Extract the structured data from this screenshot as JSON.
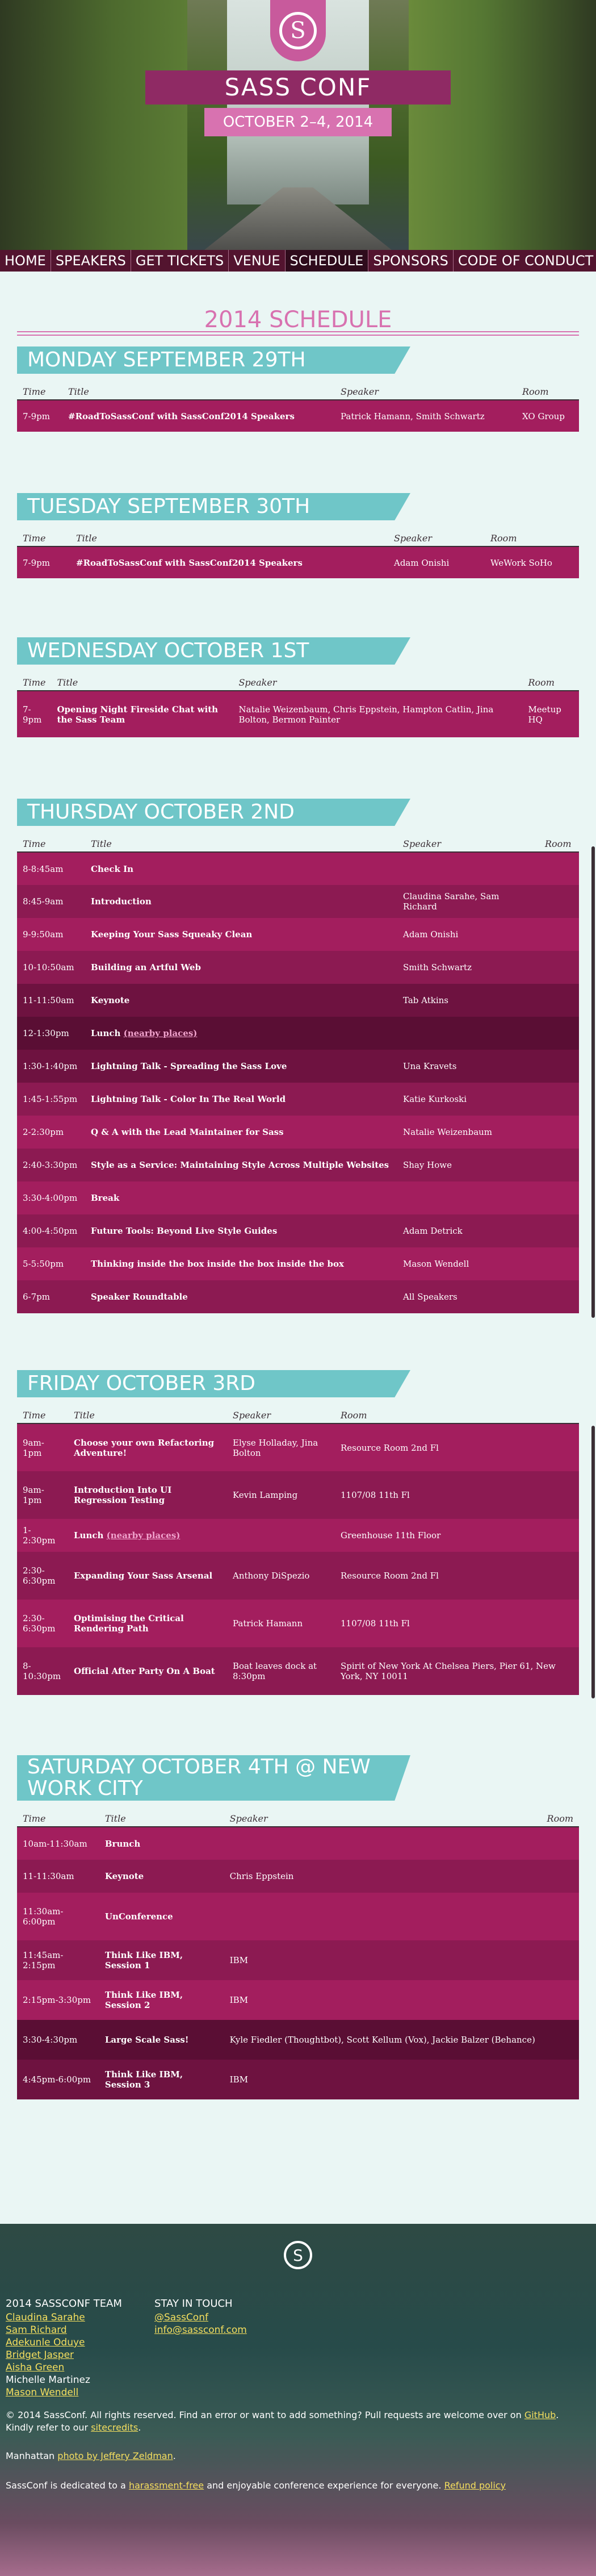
{
  "hero": {
    "logo_glyph": "S",
    "title": "SASS CONF",
    "dates": "OCTOBER 2–4, 2014"
  },
  "nav": {
    "items": [
      "HOME",
      "SPEAKERS",
      "GET TICKETS",
      "VENUE",
      "SCHEDULE",
      "SPONSORS",
      "CODE OF CONDUCT"
    ],
    "active": "SCHEDULE"
  },
  "page_title": "2014 SCHEDULE",
  "days": [
    {
      "heading": "MONDAY SEPTEMBER 29TH",
      "columns": [
        "Time",
        "Title",
        "Speaker",
        "Room"
      ],
      "rows": [
        [
          "7-9pm",
          "#RoadToSassConf with SassConf2014 Speakers",
          "Patrick Hamann, Smith Schwartz",
          "XO Group"
        ]
      ]
    },
    {
      "heading": "TUESDAY SEPTEMBER 30TH",
      "columns": [
        "Time",
        "Title",
        "Speaker",
        "Room"
      ],
      "rows": [
        [
          "7-9pm",
          "#RoadToSassConf with SassConf2014 Speakers",
          "Adam Onishi",
          "WeWork SoHo"
        ]
      ]
    },
    {
      "heading": "WEDNESDAY OCTOBER 1ST",
      "columns": [
        "Time",
        "Title",
        "Speaker",
        "Room"
      ],
      "rows": [
        [
          "7-9pm",
          "Opening Night Fireside Chat with the Sass Team",
          "Natalie Weizenbaum, Chris Eppstein, Hampton Catlin, Jina Bolton, Bermon Painter",
          "Meetup HQ"
        ]
      ]
    },
    {
      "heading": "THURSDAY OCTOBER 2ND",
      "columns": [
        "Time",
        "Title",
        "Speaker",
        "Room"
      ],
      "rows": [
        [
          "8-8:45am",
          "Check In",
          "",
          ""
        ],
        [
          "8:45-9am",
          "Introduction",
          "Claudina Sarahe, Sam Richard",
          ""
        ],
        [
          "9-9:50am",
          "Keeping Your Sass Squeaky Clean",
          "Adam Onishi",
          ""
        ],
        [
          "10-10:50am",
          "Building an Artful Web",
          "Smith Schwartz",
          ""
        ],
        [
          "11-11:50am",
          "Keynote",
          "Tab Atkins",
          ""
        ],
        [
          "12-1:30pm",
          "Lunch",
          "",
          ""
        ],
        [
          "1:30-1:40pm",
          "Lightning Talk - Spreading the Sass Love",
          "Una Kravets",
          ""
        ],
        [
          "1:45-1:55pm",
          "Lightning Talk - Color In The Real World",
          "Katie Kurkoski",
          ""
        ],
        [
          "2-2:30pm",
          "Q & A with the Lead Maintainer for Sass",
          "Natalie Weizenbaum",
          ""
        ],
        [
          "2:40-3:30pm",
          "Style as a Service: Maintaining Style Across Multiple Websites",
          "Shay Howe",
          ""
        ],
        [
          "3:30-4:00pm",
          "Break",
          "",
          ""
        ],
        [
          "4:00-4:50pm",
          "Future Tools: Beyond Live Style Guides",
          "Adam Detrick",
          ""
        ],
        [
          "5-5:50pm",
          "Thinking inside the box inside the box inside the box",
          "Mason Wendell",
          ""
        ],
        [
          "6-7pm",
          "Speaker Roundtable",
          "All Speakers",
          ""
        ]
      ],
      "lunch_link": "(nearby places)"
    },
    {
      "heading": "FRIDAY OCTOBER 3RD",
      "columns": [
        "Time",
        "Title",
        "Speaker",
        "Room"
      ],
      "rows": [
        [
          "9am-1pm",
          "Choose your own Refactoring Adventure!",
          "Elyse Holladay, Jina Bolton",
          "Resource Room 2nd Fl"
        ],
        [
          "9am-1pm",
          "Introduction Into UI Regression Testing",
          "Kevin Lamping",
          "1107/08 11th Fl"
        ],
        [
          "1-2:30pm",
          "Lunch",
          "",
          "Greenhouse 11th Floor"
        ],
        [
          "2:30-6:30pm",
          "Expanding Your Sass Arsenal",
          "Anthony DiSpezio",
          "Resource Room 2nd Fl"
        ],
        [
          "2:30-6:30pm",
          "Optimising the Critical Rendering Path",
          "Patrick Hamann",
          "1107/08 11th Fl"
        ],
        [
          "8-10:30pm",
          "Official After Party On A Boat",
          "Boat leaves dock at 8:30pm",
          "Spirit of New York At Chelsea Piers, Pier 61, New York, NY 10011"
        ]
      ],
      "lunch_link": "(nearby places)",
      "pier_link": "Pier 61, New York, NY 10011"
    },
    {
      "heading": "SATURDAY OCTOBER 4TH @ NEW WORK CITY",
      "columns": [
        "Time",
        "Title",
        "Speaker",
        "Room"
      ],
      "rows": [
        [
          "10am-11:30am",
          "Brunch",
          "",
          ""
        ],
        [
          "11-11:30am",
          "Keynote",
          "Chris Eppstein",
          ""
        ],
        [
          "11:30am-6:00pm",
          "UnConference",
          "",
          ""
        ],
        [
          "11:45am-2:15pm",
          "Think Like IBM, Session 1",
          "IBM",
          ""
        ],
        [
          "2:15pm-3:30pm",
          "Think Like IBM, Session 2",
          "IBM",
          ""
        ],
        [
          "3:30-4:30pm",
          "Large Scale Sass!",
          "Kyle Fiedler (Thoughtbot), Scott Kellum (Vox), Jackie Balzer (Behance)",
          ""
        ],
        [
          "4:45pm-6:00pm",
          "Think Like IBM, Session 3",
          "IBM",
          ""
        ]
      ]
    }
  ],
  "footer": {
    "logo_glyph": "S",
    "team_heading": "2014 SASSCONF TEAM",
    "team": [
      "Claudina Sarahe",
      "Sam Richard",
      "Adekunle Oduye",
      "Bridget Jasper",
      "Aisha Green",
      "Michelle Martinez",
      "Mason Wendell"
    ],
    "team_linked": [
      true,
      true,
      true,
      true,
      true,
      false,
      true
    ],
    "contact_heading": "STAY IN TOUCH",
    "contact": [
      "@SassConf",
      "info@sassconf.com"
    ],
    "copyright_pre": "© 2014 SassConf. All rights reserved. Find an error or want to add something? Pull requests are welcome over on",
    "copyright_link": "GitHub",
    "copyright_post": ". Kindly refer to our",
    "copyright_link2": "sitecredits",
    "photo_pre": "Manhattan",
    "photo_link": "photo by Jeffery Zeldman",
    "photo_post": ".",
    "coc_pre": "SassConf is dedicated to a",
    "coc_link": "harassment-free",
    "coc_mid": "and enjoyable conference experience for everyone.",
    "coc_link2": "Refund policy",
    "colors": {
      "accent_pink": "#d872b0",
      "deep_magenta": "#8f2a64",
      "teal": "#6fc6c8",
      "link_yellow": "#f5df5e"
    }
  }
}
